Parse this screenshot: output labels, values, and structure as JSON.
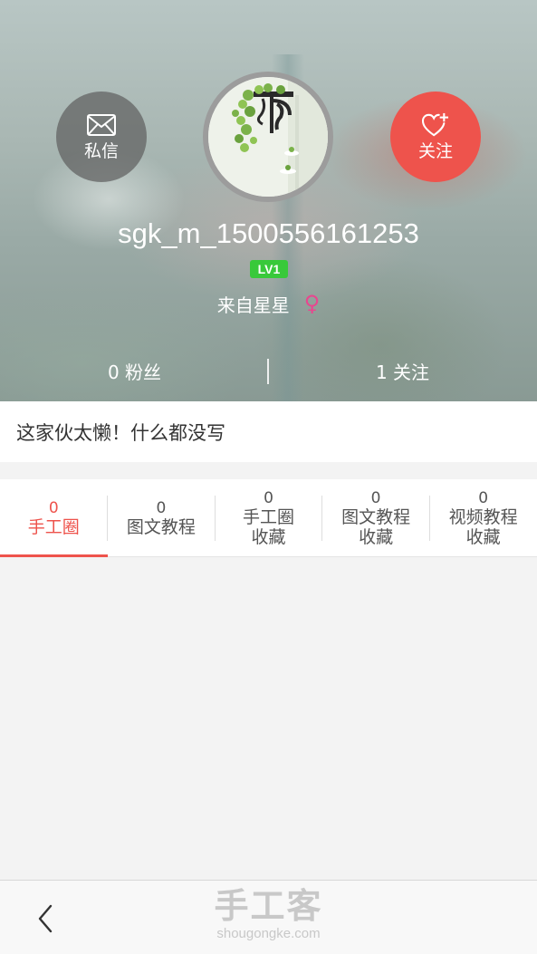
{
  "profile": {
    "username": "sgk_m_1500556161253",
    "level": "LV1",
    "location": "来自星星",
    "gender_symbol": "♀",
    "fans": "0 粉丝",
    "follows": "1 关注",
    "bio": "这家伙太懒！什么都没写"
  },
  "actions": {
    "message_label": "私信",
    "follow_label": "关注"
  },
  "tabs": [
    {
      "count": "0",
      "label": "手工圈",
      "label2": "",
      "active": true
    },
    {
      "count": "0",
      "label": "图文教程",
      "label2": "",
      "active": false
    },
    {
      "count": "0",
      "label": "手工圈",
      "label2": "收藏",
      "active": false
    },
    {
      "count": "0",
      "label": "图文教程",
      "label2": "收藏",
      "active": false
    },
    {
      "count": "0",
      "label": "视频教程",
      "label2": "收藏",
      "active": false
    }
  ],
  "footer": {
    "brand_name": "手工客",
    "brand_domain": "shougongke.com"
  },
  "colors": {
    "accent": "#ee534c",
    "level_badge": "#38c93a",
    "gender": "#e8478f"
  },
  "icons": {
    "message": "envelope-icon",
    "follow": "heart-plus-icon",
    "back": "chevron-left-icon"
  }
}
